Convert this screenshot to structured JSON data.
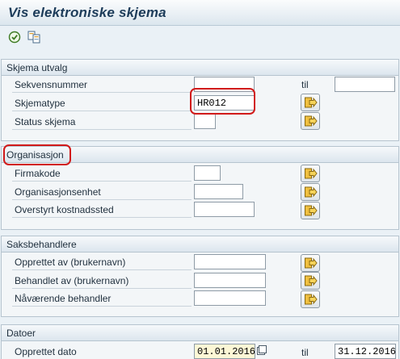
{
  "window": {
    "title": "Vis elektroniske skjema"
  },
  "toolbar": {
    "icons": [
      "execute-icon",
      "get-variant-icon"
    ]
  },
  "groups": {
    "skjema": {
      "title": "Skjema utvalg",
      "sekvensnummer": {
        "label": "Sekvensnummer",
        "value": "",
        "to_value": ""
      },
      "skjematype": {
        "label": "Skjematype",
        "value": "HR012"
      },
      "status": {
        "label": "Status skjema",
        "value": ""
      }
    },
    "org": {
      "title": "Organisasjon",
      "firmakode": {
        "label": "Firmakode",
        "value": ""
      },
      "orgenhet": {
        "label": "Organisasjonsenhet",
        "value": ""
      },
      "kostnadssted": {
        "label": "Overstyrt kostnadssted",
        "value": ""
      }
    },
    "saks": {
      "title": "Saksbehandlere",
      "opprettet_av": {
        "label": "Opprettet av (brukernavn)",
        "value": ""
      },
      "behandlet_av": {
        "label": "Behandlet av (brukernavn)",
        "value": ""
      },
      "navaerende": {
        "label": "Nåværende behandler",
        "value": ""
      }
    },
    "datoer": {
      "title": "Datoer",
      "opprettet_dato": {
        "label": "Opprettet dato",
        "value": "01.01.2016",
        "to_value": "31.12.2016"
      }
    }
  },
  "range_to_label": "til",
  "colors": {
    "annotation": "#d11a1a",
    "date_field_bg": "#fdf7d6",
    "title": "#1d3c5a"
  }
}
